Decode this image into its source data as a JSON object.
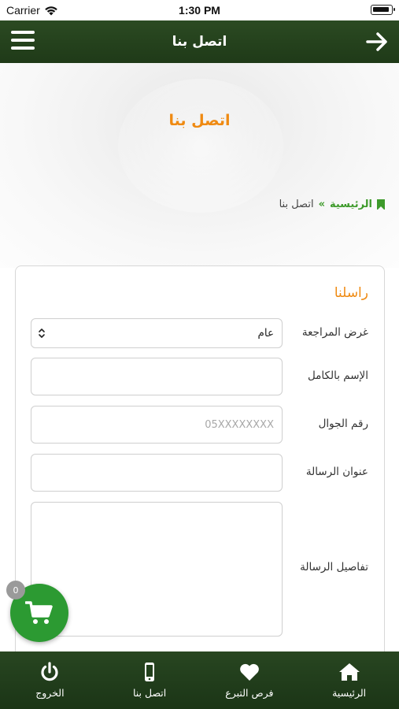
{
  "status_bar": {
    "carrier": "Carrier",
    "time": "1:30 PM"
  },
  "header": {
    "title": "اتصل بنا",
    "menu_icon": "hamburger-menu-icon",
    "back_icon": "arrow-right-icon"
  },
  "hero": {
    "title": "اتصل بنا"
  },
  "breadcrumb": {
    "home": "الرئيسية",
    "separator": "»",
    "current": "اتصل بنا"
  },
  "form": {
    "title": "راسلنا",
    "purpose": {
      "label": "غرض المراجعة",
      "value": "عام"
    },
    "full_name": {
      "label": "الإسم بالكامل",
      "value": ""
    },
    "mobile": {
      "label": "رقم الجوال",
      "placeholder": "05XXXXXXXX"
    },
    "subject": {
      "label": "عنوان الرسالة",
      "value": ""
    },
    "details": {
      "label": "تفاصيل الرسالة",
      "value": ""
    }
  },
  "cart": {
    "count": "0"
  },
  "tabbar": [
    {
      "label": "الرئيسية",
      "icon": "home-icon"
    },
    {
      "label": "فرص التبرع",
      "icon": "heart-icon"
    },
    {
      "label": "اتصل بنا",
      "icon": "mobile-phone-icon"
    },
    {
      "label": "الخروج",
      "icon": "power-icon"
    }
  ],
  "colors": {
    "header_green": "#2b4a22",
    "accent_orange": "#ef8a12",
    "link_green": "#3d9a2a",
    "cart_green": "#2c9a32"
  }
}
